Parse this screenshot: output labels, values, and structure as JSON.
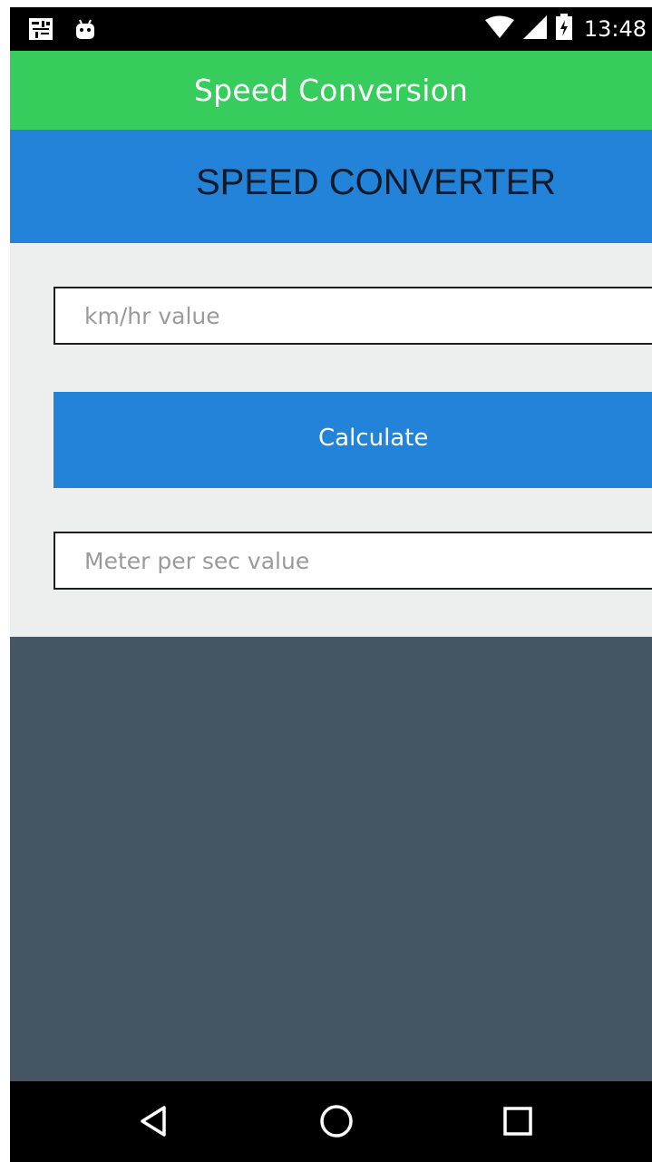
{
  "status_bar": {
    "time": "13:48",
    "icons": [
      "notification-icon",
      "android-icon",
      "wifi-icon",
      "signal-icon",
      "battery-icon"
    ]
  },
  "toolbar": {
    "title": "Speed Conversion",
    "color": "#36cd5c"
  },
  "banner": {
    "title": "SPEED CONVERTER",
    "color": "#2283d9"
  },
  "form": {
    "kmh_input": {
      "value": "",
      "placeholder": "km/hr value"
    },
    "calculate_button": {
      "label": "Calculate",
      "color": "#2283d9"
    },
    "mps_input": {
      "value": "",
      "placeholder": "Meter per sec value"
    }
  },
  "bottom_panel": {
    "color": "#455564"
  },
  "nav_bar": {
    "buttons": [
      "back-icon",
      "home-icon",
      "recents-icon"
    ]
  }
}
